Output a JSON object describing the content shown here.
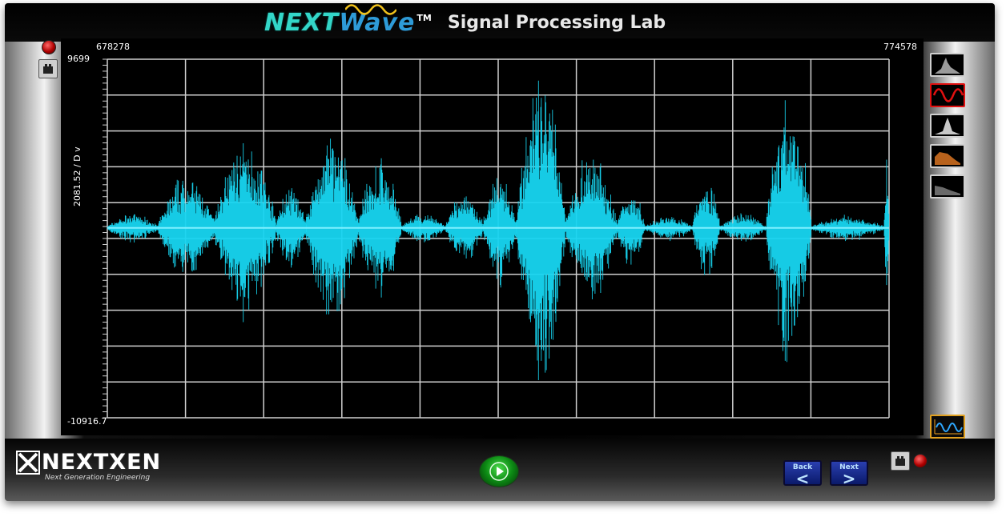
{
  "header": {
    "brand_next": "NEXT",
    "brand_wave": "Wave",
    "brand_tm": "TM",
    "title": "Signal Processing Lab"
  },
  "plot": {
    "x_start": "678278",
    "x_end": "774578",
    "y_max": "9699",
    "y_min": "-10916.7",
    "y_label": "2081.52 / D v",
    "background": "#000000",
    "grid_color": "#cfcfcf",
    "wave_color": "#18d6f2"
  },
  "chart_data": {
    "type": "line",
    "x_range": [
      678278,
      774578
    ],
    "ylim": [
      -10916.7,
      9699
    ],
    "grid": true,
    "series": [
      {
        "color": "#18d6f2",
        "segments": [
          {
            "x_start": 678278,
            "x_end": 684600,
            "amplitude": 900
          },
          {
            "x_start": 684600,
            "x_end": 691500,
            "amplitude": 3300
          },
          {
            "x_start": 691500,
            "x_end": 699000,
            "amplitude": 5700
          },
          {
            "x_start": 699000,
            "x_end": 702800,
            "amplitude": 2600
          },
          {
            "x_start": 702800,
            "x_end": 709200,
            "amplitude": 5800
          },
          {
            "x_start": 709200,
            "x_end": 714500,
            "amplitude": 4400
          },
          {
            "x_start": 714500,
            "x_end": 720000,
            "amplitude": 900
          },
          {
            "x_start": 720000,
            "x_end": 724600,
            "amplitude": 2200
          },
          {
            "x_start": 724600,
            "x_end": 728700,
            "amplitude": 3500
          },
          {
            "x_start": 728700,
            "x_end": 734700,
            "amplitude": 9700
          },
          {
            "x_start": 734700,
            "x_end": 741000,
            "amplitude": 4600
          },
          {
            "x_start": 741000,
            "x_end": 744500,
            "amplitude": 2500
          },
          {
            "x_start": 744500,
            "x_end": 750400,
            "amplitude": 800
          },
          {
            "x_start": 750400,
            "x_end": 753700,
            "amplitude": 3300
          },
          {
            "x_start": 753700,
            "x_end": 759500,
            "amplitude": 900
          },
          {
            "x_start": 759500,
            "x_end": 765000,
            "amplitude": 8300
          },
          {
            "x_start": 765000,
            "x_end": 774000,
            "amplitude": 800
          },
          {
            "x_start": 774000,
            "x_end": 774578,
            "amplitude": 4500
          }
        ]
      }
    ]
  },
  "side_buttons": [
    {
      "name": "spectrum-gray-icon",
      "color": "#a0a0a0"
    },
    {
      "name": "waveform-red-icon",
      "color": "#e01010"
    },
    {
      "name": "spectrum-white-icon",
      "color": "#d0d0d0"
    },
    {
      "name": "spectrum-orange-icon",
      "color": "#c06a20"
    },
    {
      "name": "spectrum-dark-icon",
      "color": "#707070"
    }
  ],
  "footer": {
    "logo_text": "NEXTXEN",
    "logo_sub": "Next Generation Engineering",
    "back_label": "Back",
    "back_arrow": "<",
    "next_label": "Next",
    "next_arrow": ">"
  }
}
